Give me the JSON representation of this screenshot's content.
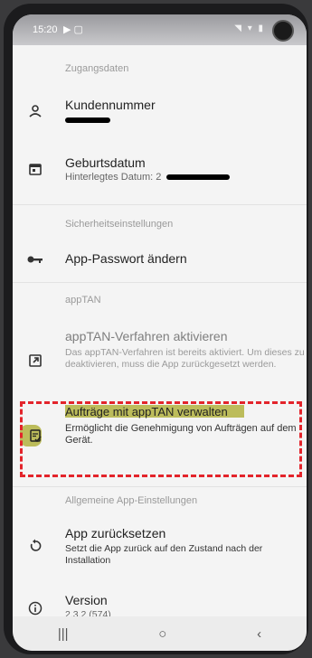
{
  "status": {
    "time": "15:20"
  },
  "sections": {
    "access": "Zugangsdaten",
    "security": "Sicherheitseinstellungen",
    "apptan": "appTAN",
    "general": "Allgemeine App-Einstellungen"
  },
  "items": {
    "customer_number": {
      "title": "Kundennummer"
    },
    "birthdate": {
      "title": "Geburtsdatum",
      "subtitle": "Hinterlegtes Datum: 2"
    },
    "password": {
      "title": "App-Passwort ändern"
    },
    "activate": {
      "title": "appTAN-Verfahren aktivieren",
      "subtitle": "Das appTAN-Verfahren ist bereits aktiviert. Um dieses zu deaktivieren, muss die App zurückgesetzt werden."
    },
    "manage": {
      "title": "Aufträge mit appTAN verwalten",
      "subtitle": "Ermöglicht die Genehmigung von Aufträgen auf dem Gerät."
    },
    "reset": {
      "title": "App zurücksetzen",
      "subtitle": "Setzt die App zurück auf den Zustand nach der Installation"
    },
    "version": {
      "title": "Version",
      "subtitle": "2.3.2 (574)"
    }
  },
  "icons": {
    "person": "person-icon",
    "calendar": "calendar-icon",
    "key": "key-icon",
    "open": "open-in-new-icon",
    "manage": "document-check-icon",
    "reset": "reset-icon",
    "info": "info-icon"
  },
  "colors": {
    "highlight": "#a9a828",
    "dashed_frame": "#e3242b"
  }
}
